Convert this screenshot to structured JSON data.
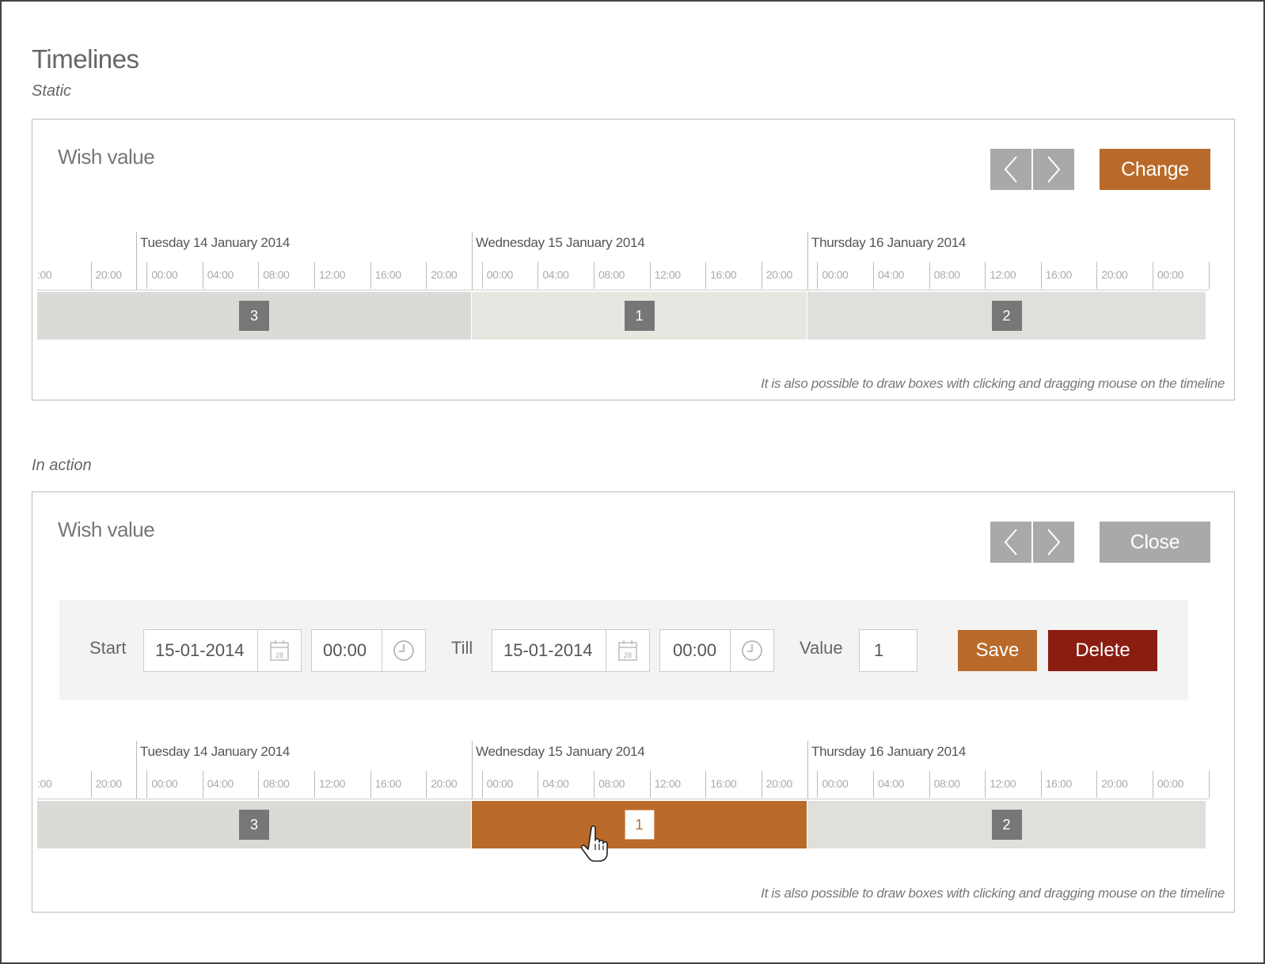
{
  "page": {
    "title": "Timelines"
  },
  "sections": {
    "static_label": "Static",
    "action_label": "In action"
  },
  "static_panel": {
    "title": "Wish value",
    "change_label": "Change",
    "hint": "It is also possible to draw boxes with clicking and dragging mouse on the timeline"
  },
  "action_panel": {
    "title": "Wish value",
    "close_label": "Close",
    "hint": "It is also possible to draw boxes with clicking and dragging mouse on the timeline",
    "editor": {
      "start_label": "Start",
      "start_date": "15-01-2014",
      "start_time": "00:00",
      "till_label": "Till",
      "till_date": "15-01-2014",
      "till_time": "00:00",
      "value_label": "Value",
      "value": "1",
      "save_label": "Save",
      "delete_label": "Delete",
      "calendar_icon_day": "28"
    }
  },
  "timeline": {
    "days": [
      "Tuesday 14 January 2014",
      "Wednesday 15 January 2014",
      "Thursday 16 January 2014"
    ],
    "hours": [
      ":00",
      "20:00",
      "00:00",
      "04:00",
      "08:00",
      "12:00",
      "16:00",
      "20:00",
      "00:00",
      "04:00",
      "08:00",
      "12:00",
      "16:00",
      "20:00",
      "00:00",
      "04:00",
      "08:00",
      "12:00",
      "16:00",
      "20:00",
      "00:00"
    ],
    "segments": [
      {
        "value": "3",
        "day": "Tuesday 14 January 2014"
      },
      {
        "value": "1",
        "day": "Wednesday 15 January 2014"
      },
      {
        "value": "2",
        "day": "Thursday 16 January 2014"
      }
    ],
    "selected_segment_value": "1"
  },
  "colors": {
    "accent": "#b96a2a",
    "danger": "#8b1c12",
    "nav_gray": "#a9a9a9",
    "badge_gray": "#777777"
  },
  "icons": {
    "prev": "chevron-left-icon",
    "next": "chevron-right-icon",
    "calendar": "calendar-icon",
    "clock": "clock-icon",
    "cursor": "hand-pointer-icon"
  }
}
